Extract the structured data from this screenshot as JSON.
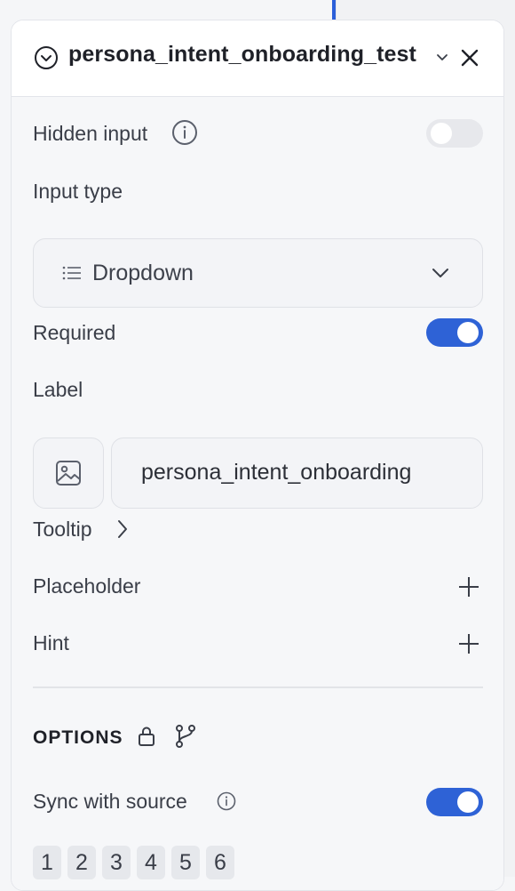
{
  "panel": {
    "title": "persona_intent_onboarding_test"
  },
  "hidden_input": {
    "label": "Hidden input",
    "enabled": false
  },
  "input_type": {
    "label": "Input type",
    "value": "Dropdown"
  },
  "required": {
    "label": "Required",
    "enabled": true
  },
  "label_field": {
    "label": "Label",
    "value": "persona_intent_onboarding"
  },
  "tooltip": {
    "label": "Tooltip"
  },
  "placeholder": {
    "label": "Placeholder"
  },
  "hint": {
    "label": "Hint"
  },
  "options": {
    "title": "OPTIONS",
    "sync_label": "Sync with source",
    "sync_enabled": true,
    "chips": [
      "1",
      "2",
      "3",
      "4",
      "5",
      "6"
    ]
  },
  "colors": {
    "accent": "#2e62d6",
    "text": "#3a3e48",
    "title": "#1f2128"
  }
}
